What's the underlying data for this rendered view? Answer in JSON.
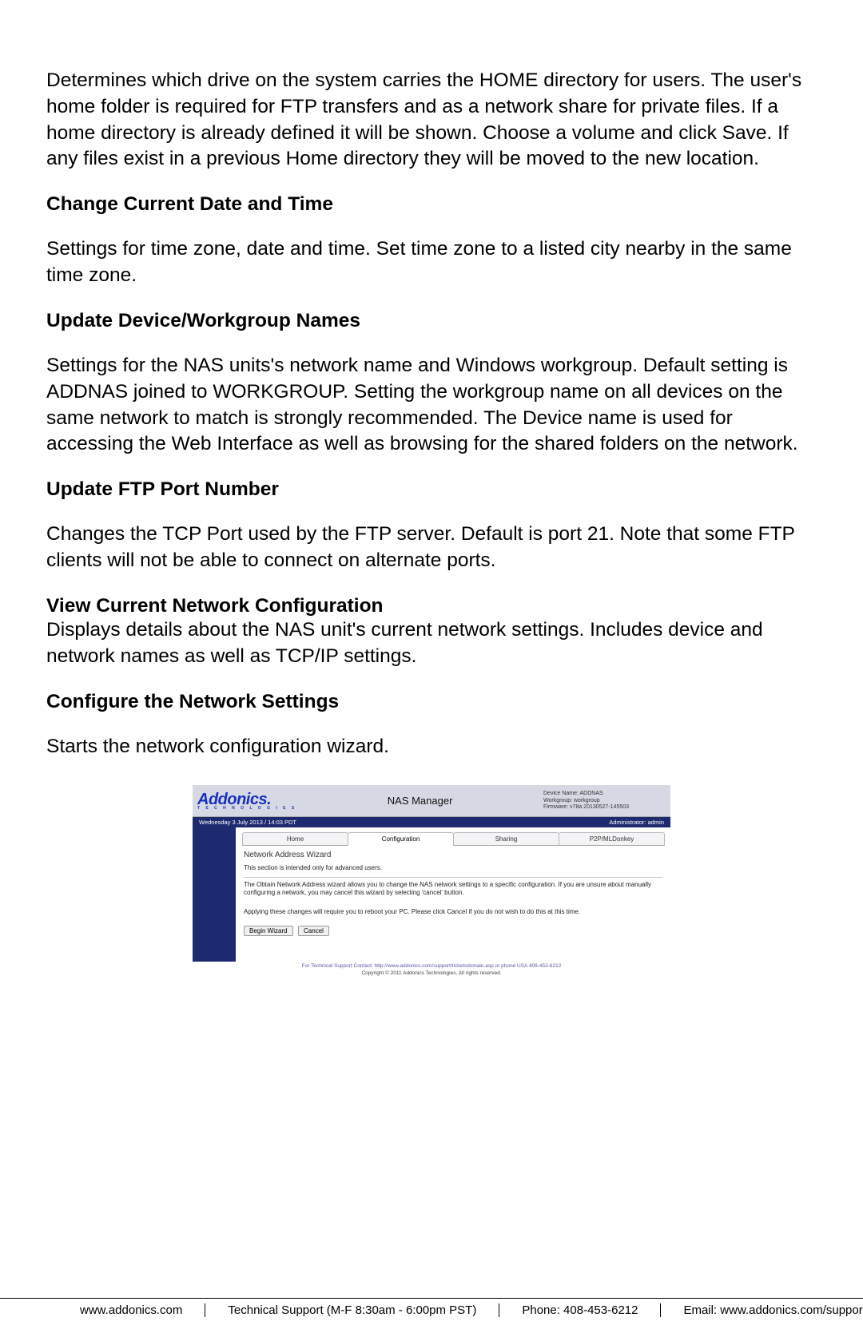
{
  "doc": {
    "intro": "Determines which drive on the system carries the HOME directory for users. The user's home folder is required for FTP transfers and as a network share for private files. If a home directory is already defined it will be shown. Choose a volume and click Save. If any files exist in a previous Home directory they will be moved to the new location.",
    "h1": "Change Current Date and Time",
    "p1": "Settings for time zone, date and time. Set time zone to a listed city nearby in the same time zone.",
    "h2": "Update Device/Workgroup Names",
    "p2": "Settings for the NAS units's network name and Windows workgroup. Default setting is ADDNAS joined to WORKGROUP. Setting the workgroup name on all devices on the same network to match is strongly recommended. The Device name is used for accessing the Web Interface as well as browsing for the shared folders on the network.",
    "h3": "Update FTP Port Number",
    "p3": "Changes the TCP Port used by the FTP server. Default is port 21. Note that some FTP clients will not be able to connect on alternate ports.",
    "h4": "View Current Network Configuration",
    "p4": "Displays details about the NAS unit's current network settings. Includes device and network names as well as TCP/IP settings.",
    "h5": "Configure the Network Settings",
    "p5": "Starts the network configuration wizard."
  },
  "nas": {
    "logo_main": "Addonics",
    "logo_sub": "T E C H N O L O G I E S",
    "title": "NAS Manager",
    "info_device": "Device Name: ADDNAS",
    "info_workgroup": "Workgroup: workgroup",
    "info_firmware": "Firmware: v78a 20130527-145503",
    "dateline": "Wednesday 3 July 2013 / 14:03 PDT",
    "adminline": "Administrator:  admin",
    "tabs": {
      "home": "Home",
      "config": "Configuration",
      "sharing": "Sharing",
      "p2p": "P2P/MLDonkey"
    },
    "wizard_title": "Network Address Wizard",
    "wizard_p1": "This section is intended only for advanced users.",
    "wizard_p2": "The Obtain Network Address wizard allows you to change the NAS network settings to a specific configuration. If you are unsure about manually configuring a network, you may cancel this wizard by selecting 'cancel' button.",
    "wizard_p3": "Applying these changes will require you to reboot your PC. Please click Cancel if you do not wish to do this at this time.",
    "btn_begin": "Begin Wizard",
    "btn_cancel": "Cancel",
    "foot_support": "For Technical Support Contact: http://www.addonics.com/support/ticketsdomain.asp or phone USA 408-453-6212",
    "foot_copy": "Copyright © 2011 Addonics Technologies, All rights reserved."
  },
  "footer": {
    "site": "www.addonics.com",
    "support": "Technical Support (M-F 8:30am - 6:00pm PST)",
    "phone": "Phone: 408-453-6212",
    "email": "Email: www.addonics.com/support/query/"
  }
}
